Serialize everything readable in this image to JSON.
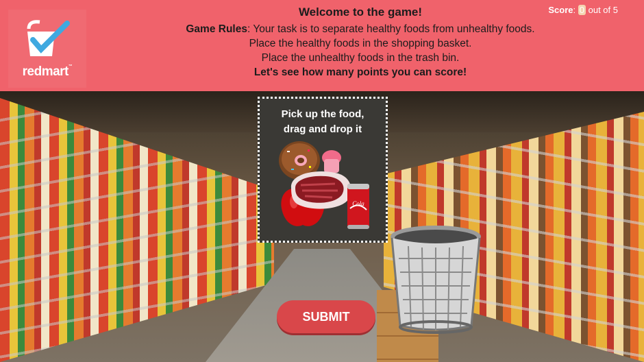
{
  "header": {
    "logo_text": "redmart",
    "title": "Welcome to the game!",
    "rules_label": "Game Rules",
    "rules_line1": ": Your task is to separate healthy foods from unhealthy foods.",
    "rules_line2": "Place the healthy foods in the shopping basket.",
    "rules_line3": "Place the unhealthy foods in the trash bin.",
    "rules_line4": "Let's see how many points you can score!"
  },
  "score": {
    "label": "Score",
    "value": "0",
    "suffix": "out of 5"
  },
  "drag_area": {
    "instruction_line1": "Pick up the food,",
    "instruction_line2": "drag and drop it",
    "foods": [
      "donut-icon",
      "apple-icon",
      "steak-icon",
      "cola-can-icon"
    ],
    "can_text": "Cola"
  },
  "submit_label": "SUBMIT",
  "colors": {
    "header_bg": "#f0626b",
    "submit_bg": "#d9474a",
    "accent_check": "#3fa9e0"
  }
}
